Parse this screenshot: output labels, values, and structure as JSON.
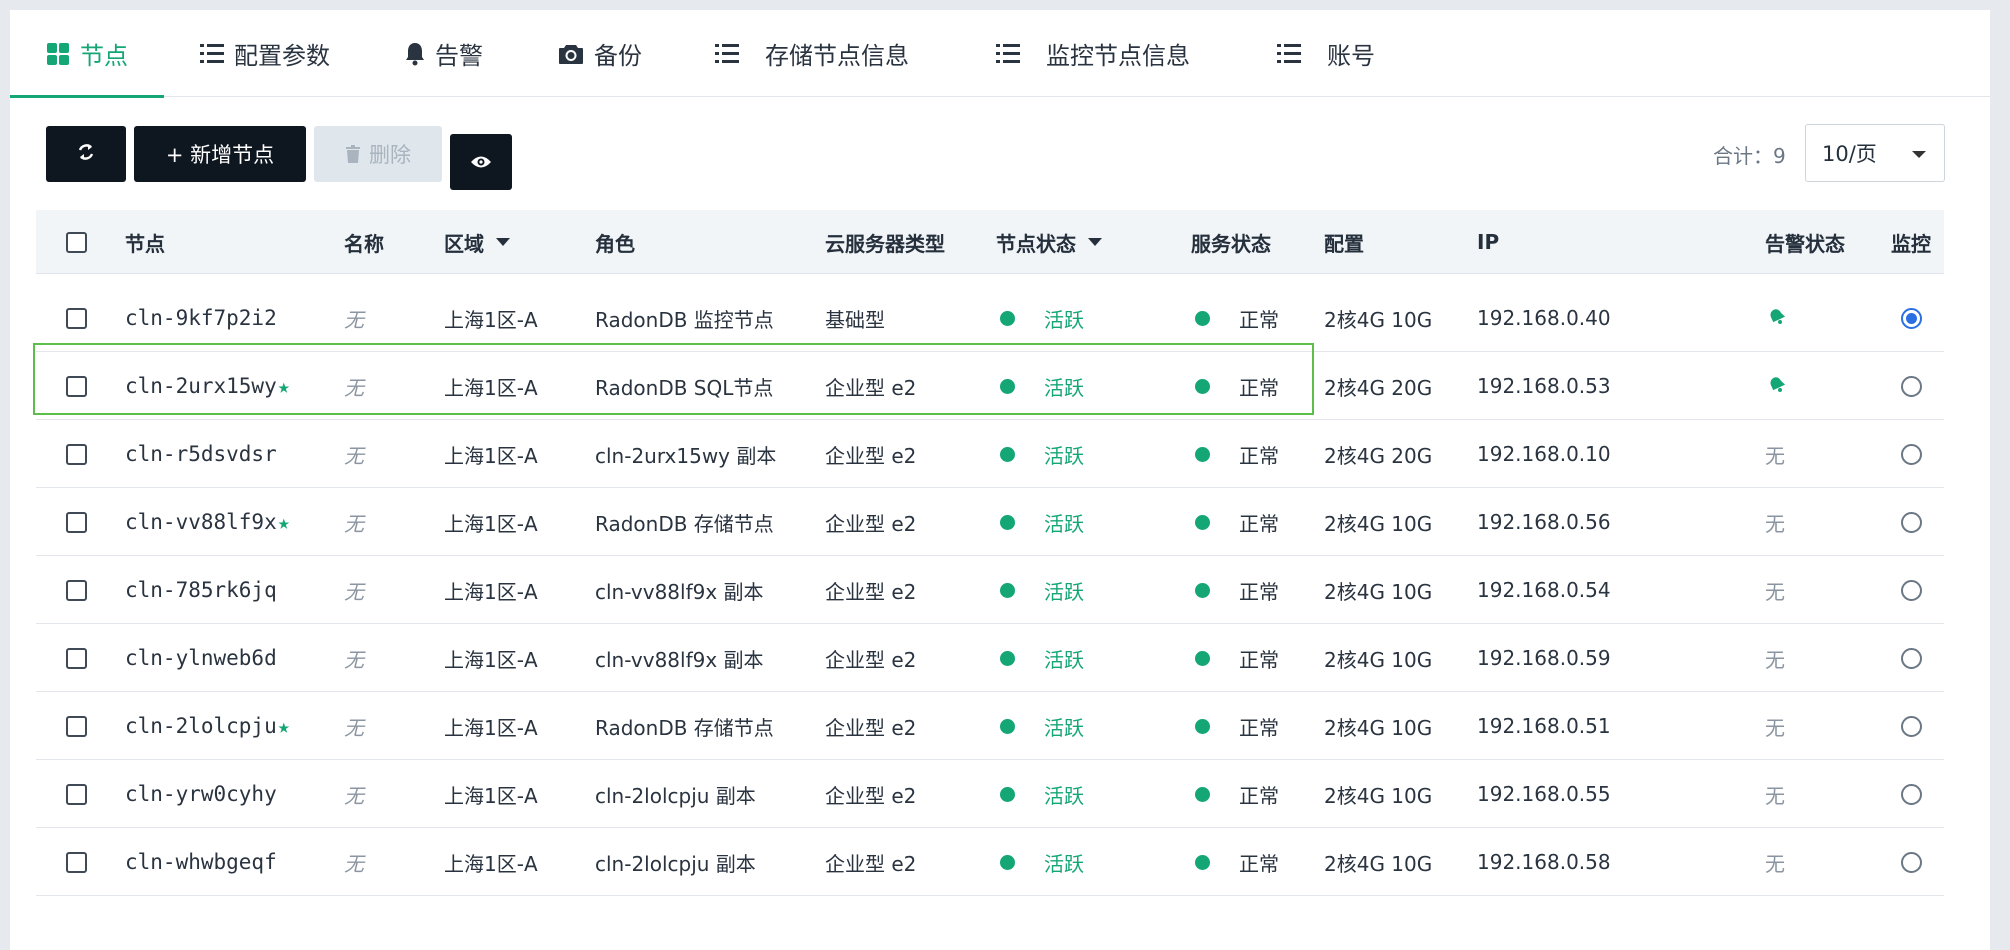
{
  "tabs": [
    {
      "label": "节点",
      "icon": "grid-icon",
      "active": true
    },
    {
      "label": "配置参数",
      "icon": "list-icon"
    },
    {
      "label": "告警",
      "icon": "bell-icon"
    },
    {
      "label": "备份",
      "icon": "camera-icon"
    },
    {
      "label": "存储节点信息",
      "icon": "list-icon"
    },
    {
      "label": "监控节点信息",
      "icon": "list-icon"
    },
    {
      "label": "账号",
      "icon": "list-icon"
    }
  ],
  "toolbar": {
    "add_label": "+ 新增节点",
    "delete_label": "删除",
    "total_label": "合计：9",
    "page_size": "10/页"
  },
  "columns": {
    "node": "节点",
    "name": "名称",
    "zone": "区域",
    "role": "角色",
    "server_type": "云服务器类型",
    "node_status": "节点状态",
    "service_status": "服务状态",
    "config": "配置",
    "ip": "IP",
    "alert_status": "告警状态",
    "monitor": "监控"
  },
  "rows": [
    {
      "node": "cln-9kf7p2i2",
      "star": false,
      "name": "无",
      "zone": "上海1区-A",
      "role": "RadonDB 监控节点",
      "server_type": "基础型",
      "node_status": "活跃",
      "service_status": "正常",
      "config": "2核4G 10G",
      "ip": "192.168.0.40",
      "alert": "bell",
      "monitor": true
    },
    {
      "node": "cln-2urx15wy",
      "star": true,
      "name": "无",
      "zone": "上海1区-A",
      "role": "RadonDB SQL节点",
      "server_type": "企业型 e2",
      "node_status": "活跃",
      "service_status": "正常",
      "config": "2核4G 20G",
      "ip": "192.168.0.53",
      "alert": "bell",
      "monitor": false
    },
    {
      "node": "cln-r5dsvdsr",
      "star": false,
      "name": "无",
      "zone": "上海1区-A",
      "role": "cln-2urx15wy 副本",
      "server_type": "企业型 e2",
      "node_status": "活跃",
      "service_status": "正常",
      "config": "2核4G 20G",
      "ip": "192.168.0.10",
      "alert": "无",
      "monitor": false
    },
    {
      "node": "cln-vv88lf9x",
      "star": true,
      "name": "无",
      "zone": "上海1区-A",
      "role": "RadonDB 存储节点",
      "server_type": "企业型 e2",
      "node_status": "活跃",
      "service_status": "正常",
      "config": "2核4G 10G",
      "ip": "192.168.0.56",
      "alert": "无",
      "monitor": false
    },
    {
      "node": "cln-785rk6jq",
      "star": false,
      "name": "无",
      "zone": "上海1区-A",
      "role": "cln-vv88lf9x 副本",
      "server_type": "企业型 e2",
      "node_status": "活跃",
      "service_status": "正常",
      "config": "2核4G 10G",
      "ip": "192.168.0.54",
      "alert": "无",
      "monitor": false
    },
    {
      "node": "cln-ylnweb6d",
      "star": false,
      "name": "无",
      "zone": "上海1区-A",
      "role": "cln-vv88lf9x 副本",
      "server_type": "企业型 e2",
      "node_status": "活跃",
      "service_status": "正常",
      "config": "2核4G 10G",
      "ip": "192.168.0.59",
      "alert": "无",
      "monitor": false
    },
    {
      "node": "cln-2lolcpju",
      "star": true,
      "name": "无",
      "zone": "上海1区-A",
      "role": "RadonDB 存储节点",
      "server_type": "企业型 e2",
      "node_status": "活跃",
      "service_status": "正常",
      "config": "2核4G 10G",
      "ip": "192.168.0.51",
      "alert": "无",
      "monitor": false
    },
    {
      "node": "cln-yrw0cyhy",
      "star": false,
      "name": "无",
      "zone": "上海1区-A",
      "role": "cln-2lolcpju 副本",
      "server_type": "企业型 e2",
      "node_status": "活跃",
      "service_status": "正常",
      "config": "2核4G 10G",
      "ip": "192.168.0.55",
      "alert": "无",
      "monitor": false
    },
    {
      "node": "cln-whwbgeqf",
      "star": false,
      "name": "无",
      "zone": "上海1区-A",
      "role": "cln-2lolcpju 副本",
      "server_type": "企业型 e2",
      "node_status": "活跃",
      "service_status": "正常",
      "config": "2核4G 10G",
      "ip": "192.168.0.58",
      "alert": "无",
      "monitor": false
    }
  ],
  "colors": {
    "accent": "#15a675",
    "dark_button": "#0e1620",
    "radio_selected": "#2b6fe3",
    "highlight_border": "#5bbf4a"
  }
}
